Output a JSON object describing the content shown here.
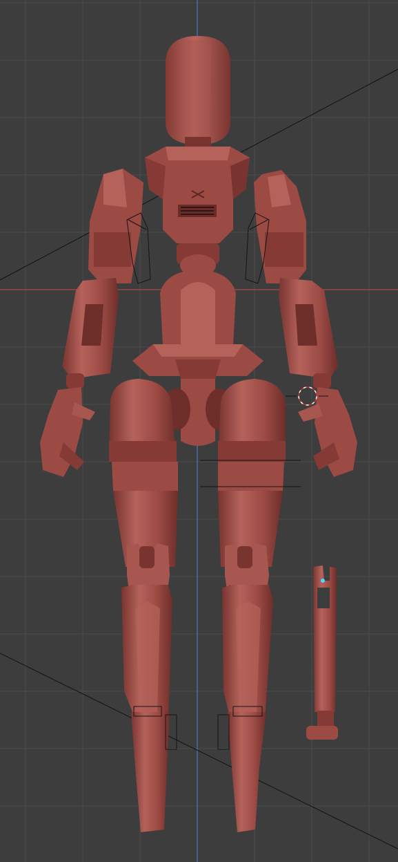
{
  "viewport": {
    "background": "#3d3d3d",
    "grid_color": "#4a4a4a",
    "axis_x_color": "#b04848",
    "axis_z_color": "#3f78b8",
    "model_color": "#9c4a44",
    "model_light": "#b4625a",
    "model_dark": "#7a3430",
    "model_shadow": "#5e2623",
    "outline_color": "#141414"
  }
}
